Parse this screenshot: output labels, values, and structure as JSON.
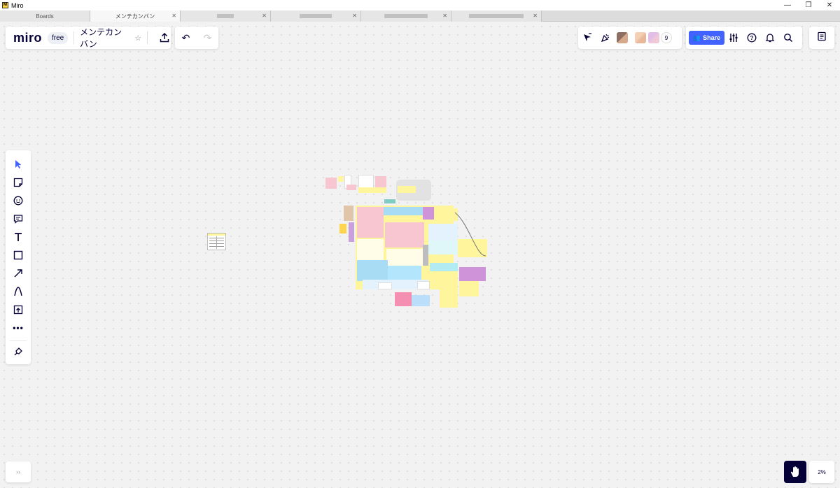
{
  "window": {
    "title": "Miro",
    "controls": {
      "minimize": "—",
      "restore": "❐",
      "close": "✕"
    }
  },
  "tabs": [
    {
      "label": "Boards",
      "active": false,
      "closable": false
    },
    {
      "label": "メンテカンバン",
      "active": true,
      "closable": true
    },
    {
      "label": "",
      "active": false,
      "closable": true,
      "blurred": true
    },
    {
      "label": "",
      "active": false,
      "closable": true,
      "blurred": true
    },
    {
      "label": "",
      "active": false,
      "closable": true,
      "blurred": true
    },
    {
      "label": "",
      "active": false,
      "closable": true,
      "blurred": true
    }
  ],
  "header": {
    "logo": "miro",
    "plan": "free",
    "board_name": "メンテカンバン"
  },
  "collaborators": {
    "count": "9"
  },
  "toolbar_right": {
    "share_label": "Share"
  },
  "zoom": {
    "level": "2%"
  },
  "left_tools": [
    {
      "name": "select-tool",
      "icon": "cursor-icon"
    },
    {
      "name": "sticky-note-tool",
      "icon": "sticky-note-icon"
    },
    {
      "name": "sticker-tool",
      "icon": "sticker-icon"
    },
    {
      "name": "comment-tool",
      "icon": "comment-icon"
    },
    {
      "name": "text-tool",
      "icon": "text-icon"
    },
    {
      "name": "shape-tool",
      "icon": "square-icon"
    },
    {
      "name": "connector-tool",
      "icon": "arrow-icon"
    },
    {
      "name": "pen-tool",
      "icon": "pen-icon"
    },
    {
      "name": "upload-tool",
      "icon": "upload-icon"
    },
    {
      "name": "more-tools",
      "icon": "more-icon"
    },
    {
      "name": "apps-tool",
      "icon": "plug-icon"
    }
  ],
  "colors": {
    "accent": "#4262ff",
    "dark": "#050038",
    "sticky_yellow": "#fff59d",
    "sticky_blue": "#a8dcf5",
    "sticky_pink": "#f7c6d0",
    "sticky_purple": "#c9a0dc"
  }
}
